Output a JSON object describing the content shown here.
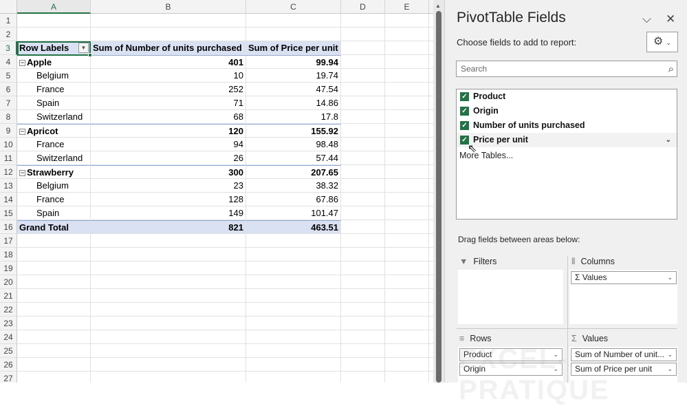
{
  "columns": [
    "A",
    "B",
    "C",
    "D",
    "E"
  ],
  "row_count": 27,
  "pivot": {
    "headers": [
      "Row Labels",
      "Sum of Number of units purchased",
      "Sum of Price per unit"
    ],
    "rows": [
      {
        "label": "Apple",
        "units": "401",
        "price": "99.94",
        "group": true
      },
      {
        "label": "Belgium",
        "units": "10",
        "price": "19.74"
      },
      {
        "label": "France",
        "units": "252",
        "price": "47.54"
      },
      {
        "label": "Spain",
        "units": "71",
        "price": "14.86"
      },
      {
        "label": "Switzerland",
        "units": "68",
        "price": "17.8"
      },
      {
        "label": "Apricot",
        "units": "120",
        "price": "155.92",
        "group": true
      },
      {
        "label": "France",
        "units": "94",
        "price": "98.48"
      },
      {
        "label": "Switzerland",
        "units": "26",
        "price": "57.44"
      },
      {
        "label": "Strawberry",
        "units": "300",
        "price": "207.65",
        "group": true
      },
      {
        "label": "Belgium",
        "units": "23",
        "price": "38.32"
      },
      {
        "label": "France",
        "units": "128",
        "price": "67.86"
      },
      {
        "label": "Spain",
        "units": "149",
        "price": "101.47"
      }
    ],
    "grand_total": {
      "label": "Grand Total",
      "units": "821",
      "price": "463.51"
    }
  },
  "panel": {
    "title": "PivotTable Fields",
    "choose_label": "Choose fields to add to report:",
    "search_placeholder": "Search",
    "fields": [
      {
        "name": "Product",
        "checked": true
      },
      {
        "name": "Origin",
        "checked": true
      },
      {
        "name": "Number of units purchased",
        "checked": true
      },
      {
        "name": "Price per unit",
        "checked": true
      }
    ],
    "more_tables": "More Tables...",
    "drag_label": "Drag fields between areas below:",
    "areas": {
      "filters": {
        "label": "Filters",
        "items": []
      },
      "columns": {
        "label": "Columns",
        "items": [
          "Σ Values"
        ]
      },
      "rows": {
        "label": "Rows",
        "items": [
          "Product",
          "Origin"
        ]
      },
      "values": {
        "label": "Values",
        "items": [
          "Sum of Number of unit...",
          "Sum of Price per unit"
        ]
      }
    }
  },
  "watermark": "EXCEL-PRATIQUE",
  "colors": {
    "accent": "#217346",
    "pivot_header": "#d9e1f2"
  }
}
